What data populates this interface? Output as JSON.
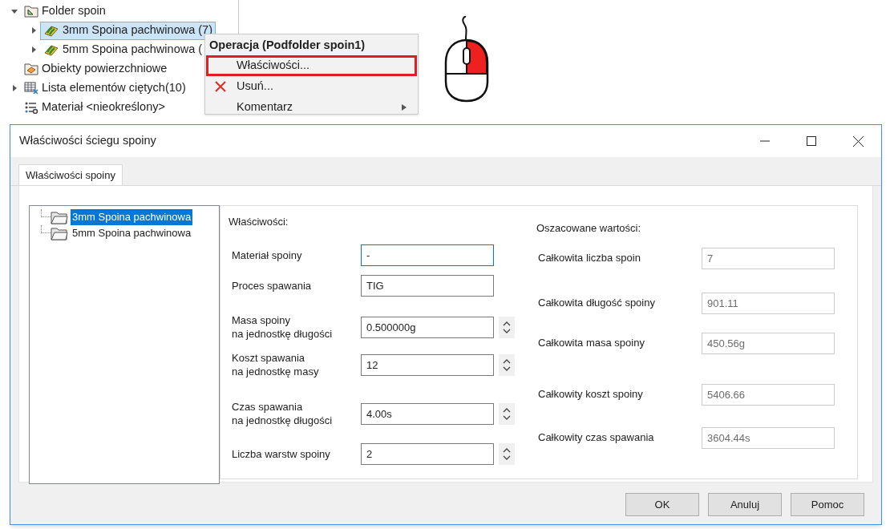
{
  "feature_tree": {
    "items": [
      {
        "label": "Folder spoin",
        "kind": "weld-folder",
        "expanded": true,
        "selected": false,
        "children": [
          {
            "label": "3mm Spoina pachwinowa (7)",
            "kind": "weld",
            "expanded": false,
            "selected": true
          },
          {
            "label": "5mm Spoina pachwinowa (",
            "kind": "weld",
            "expanded": false,
            "selected": false
          }
        ]
      },
      {
        "label": "Obiekty powierzchniowe",
        "kind": "surface",
        "selected": false
      },
      {
        "label": "Lista elementów ciętych(10)",
        "kind": "cutlist",
        "expanded": false,
        "selected": false
      },
      {
        "label": "Materiał <nieokreślony>",
        "kind": "material",
        "selected": false
      }
    ]
  },
  "context_menu": {
    "title": "Operacja (Podfolder spoin1)",
    "items": [
      {
        "label": "Właściwości...",
        "kind": "plain",
        "highlighted": true
      },
      {
        "label": "Usuń...",
        "kind": "delete",
        "highlighted": false
      },
      {
        "label": "Komentarz",
        "kind": "submenu",
        "highlighted": false
      }
    ]
  },
  "dialog": {
    "title": "Właściwości ściegu spoiny",
    "tabs": [
      {
        "label": "Właściwości spoiny",
        "selected": true
      }
    ],
    "bead_list": [
      {
        "label": "3mm Spoina pachwinowa",
        "selected": true
      },
      {
        "label": "5mm Spoina pachwinowa",
        "selected": false
      }
    ],
    "properties": {
      "heading": "Właściwości:",
      "fields": [
        {
          "label": "Materiał spoiny",
          "value": "-",
          "spinner": false,
          "focused": true
        },
        {
          "label": "Proces spawania",
          "value": "TIG",
          "spinner": false,
          "focused": false
        },
        {
          "label": "Masa spoiny\nna jednostkę długości",
          "value": "0.500000g",
          "spinner": true,
          "focused": false
        },
        {
          "label": "Koszt spawania\nna jednostkę masy",
          "value": "12",
          "spinner": true,
          "focused": false
        },
        {
          "label": "Czas spawania\nna jednostkę długości",
          "value": "4.00s",
          "spinner": true,
          "focused": false
        },
        {
          "label": "Liczba warstw spoiny",
          "value": "2",
          "spinner": true,
          "focused": false
        }
      ]
    },
    "estimates": {
      "heading": "Oszacowane wartości:",
      "fields": [
        {
          "label": "Całkowita liczba spoin",
          "value": "7"
        },
        {
          "label": "Całkowita długość spoiny",
          "value": "901.11"
        },
        {
          "label": "Całkowita masa spoiny",
          "value": "450.56g"
        },
        {
          "label": "Całkowity koszt spoiny",
          "value": "5406.66"
        },
        {
          "label": "Całkowity czas spawania",
          "value": "3604.44s"
        }
      ]
    },
    "buttons": [
      "OK",
      "Anuluj",
      "Pomoc"
    ]
  }
}
